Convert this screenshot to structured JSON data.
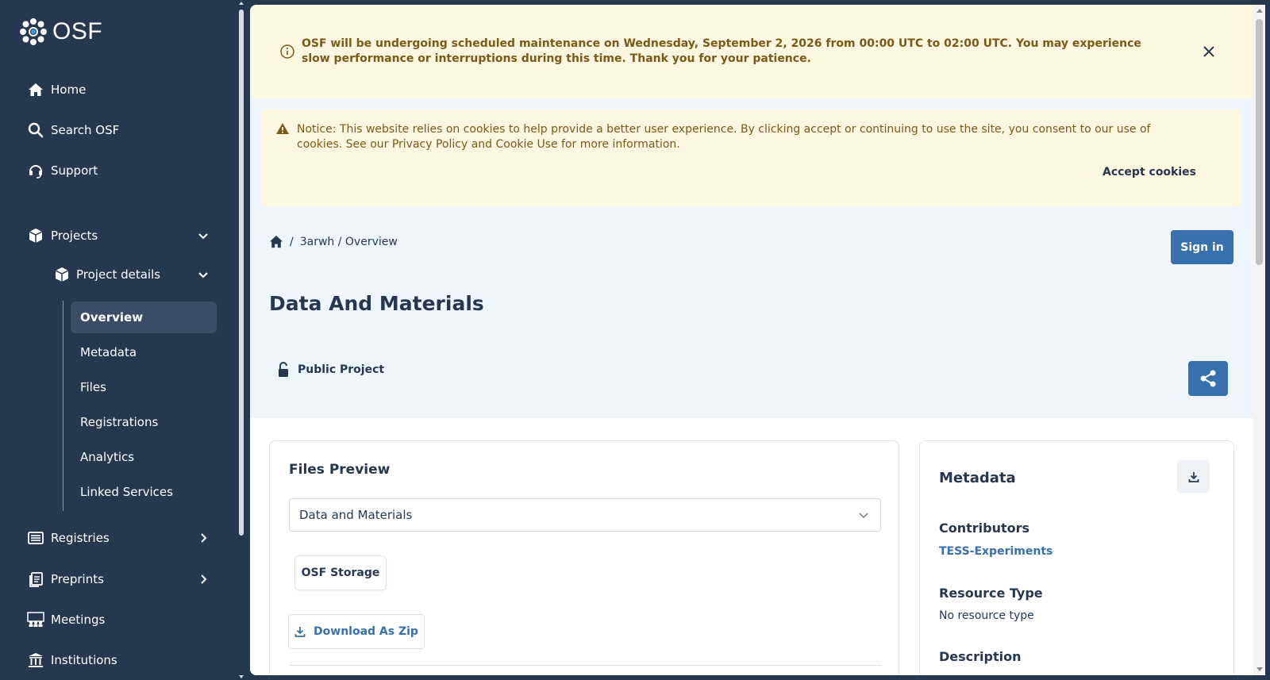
{
  "app": {
    "logo_text": "OSF"
  },
  "sidebar": {
    "home": "Home",
    "search": "Search OSF",
    "support": "Support",
    "projects": "Projects",
    "project_details": "Project details",
    "sub": [
      "Overview",
      "Metadata",
      "Files",
      "Registrations",
      "Analytics",
      "Linked Services"
    ],
    "registries": "Registries",
    "preprints": "Preprints",
    "meetings": "Meetings",
    "institutions": "Institutions"
  },
  "maintenance": {
    "text": "OSF will be undergoing scheduled maintenance on Wednesday, September 2, 2026 from 00:00 UTC to 02:00 UTC. You may experience slow performance or interruptions during this time. Thank you for your patience."
  },
  "cookie": {
    "text": "Notice: This website relies on cookies to help provide a better user experience. By clicking accept or continuing to use the site, you consent to our use of cookies. See our Privacy Policy and Cookie Use for more information.",
    "accept": "Accept cookies"
  },
  "breadcrumb": {
    "sep": "/",
    "path": "3arwh / Overview"
  },
  "header": {
    "signin": "Sign in",
    "title": "Data And Materials",
    "visibility": "Public Project"
  },
  "files": {
    "title": "Files Preview",
    "selected": "Data and Materials",
    "storage": "OSF Storage",
    "download": "Download As Zip"
  },
  "metadata": {
    "title": "Metadata",
    "contributors_label": "Contributors",
    "contributor": "TESS-Experiments",
    "resource_type_label": "Resource Type",
    "resource_type": "No resource type",
    "description_label": "Description"
  },
  "colors": {
    "sidebar": "#263850",
    "accent": "#3771ad",
    "banner": "#fdf6e1",
    "banner_text": "#7a5a16"
  }
}
